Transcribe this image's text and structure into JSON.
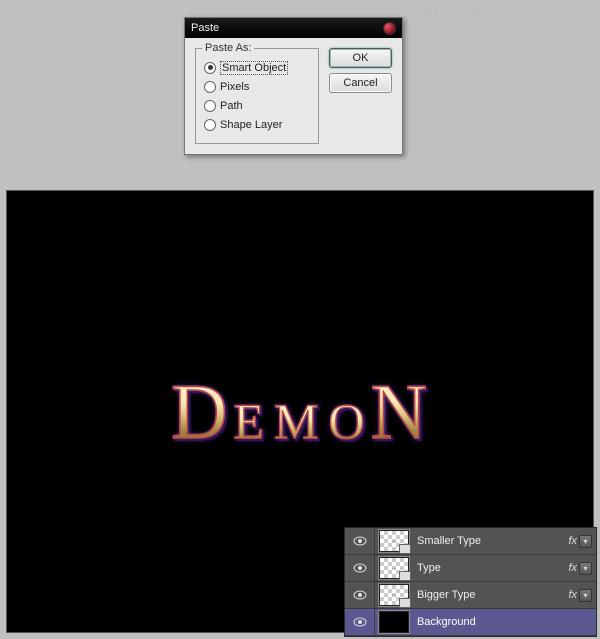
{
  "watermark": {
    "cn": "思缘设计论坛",
    "en": "WWW.MISSYUAN.COM"
  },
  "dialog": {
    "title": "Paste",
    "fieldset_legend": "Paste As:",
    "options": {
      "smart_object": "Smart Object",
      "pixels": "Pixels",
      "path": "Path",
      "shape_layer": "Shape Layer"
    },
    "selected": "smart_object",
    "buttons": {
      "ok": "OK",
      "cancel": "Cancel"
    }
  },
  "canvas": {
    "letters": {
      "l1": "D",
      "l2": "E",
      "l3": "M",
      "l4": "O",
      "l5": "N"
    }
  },
  "layers": {
    "rows": {
      "smaller_type": {
        "name": "Smaller Type",
        "fx": "fx"
      },
      "type": {
        "name": "Type",
        "fx": "fx"
      },
      "bigger_type": {
        "name": "Bigger Type",
        "fx": "fx"
      },
      "background": {
        "name": "Background"
      }
    },
    "arrow_glyph": "▾"
  }
}
